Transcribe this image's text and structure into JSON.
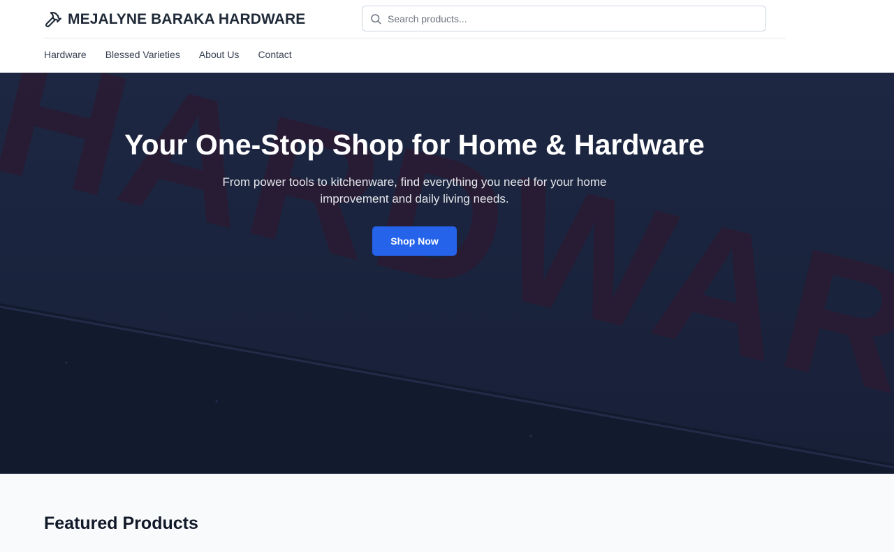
{
  "header": {
    "brand_title": "MEJALYNE BARAKA HARDWARE",
    "brand_icon": "hammer-icon",
    "search": {
      "placeholder": "Search products...",
      "value": "",
      "icon": "search-icon"
    },
    "nav": [
      {
        "label": "Hardware"
      },
      {
        "label": "Blessed Varieties"
      },
      {
        "label": "About Us"
      },
      {
        "label": "Contact"
      }
    ]
  },
  "hero": {
    "title": "Your One-Stop Shop for Home & Hardware",
    "subtitle": "From power tools to kitchenware, find everything you need for your home improvement and daily living needs.",
    "cta_label": "Shop Now",
    "background_sign_text": "HARDWARE"
  },
  "featured": {
    "title": "Featured Products"
  },
  "colors": {
    "accent": "#2563eb",
    "hero_overlay": "#17203a",
    "section_bg": "#f8fafc"
  }
}
